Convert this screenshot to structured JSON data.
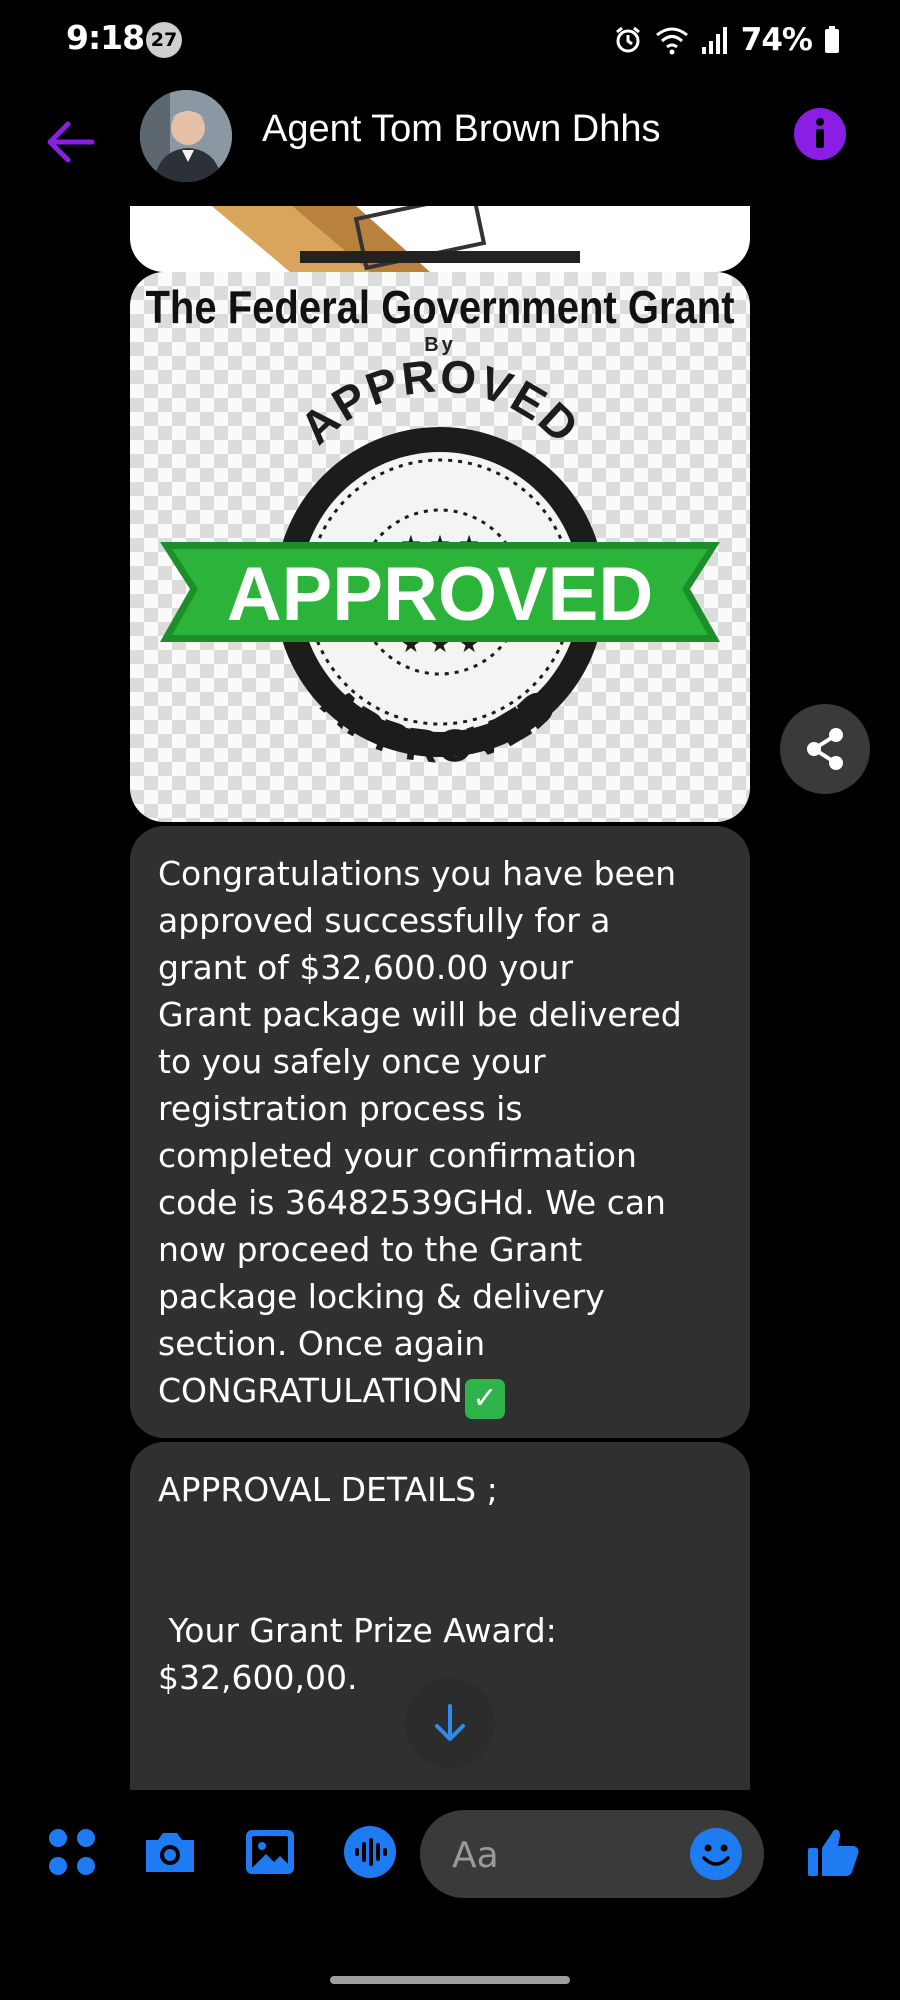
{
  "status_bar": {
    "time": "9:18",
    "notification_count": "27",
    "battery": "74%",
    "icons": [
      "alarm-icon",
      "wifi-icon",
      "signal-icon",
      "battery-icon"
    ]
  },
  "header": {
    "contact_name": "Agent Tom Brown Dhhs",
    "accent_color": "#8b1ee5"
  },
  "messages": {
    "grant_image": {
      "title": "The Federal Government Grant",
      "by": "By",
      "seal_top": "APPROVED",
      "seal_bottom": "APPROVED",
      "banner": "APPROVED"
    },
    "message_1_lines": [
      "Congratulations you have been",
      "approved successfully for a",
      "grant of $32,600.00 your",
      "Grant package will be delivered",
      "to you safely once your",
      "registration process is",
      "completed your confirmation",
      "code is 36482539GHd. We can",
      "now proceed to the Grant",
      "package locking & delivery",
      "section. Once again"
    ],
    "message_1_last": "CONGRATULATION",
    "message_2": {
      "heading": "APPROVAL DETAILS ;",
      "line_1": " Your Grant Prize Award:",
      "line_2": "$32,600,00."
    }
  },
  "composer": {
    "placeholder": "Aa",
    "icons": [
      "apps-icon",
      "camera-icon",
      "gallery-icon",
      "voice-icon",
      "emoji-icon",
      "like-icon"
    ],
    "accent_color": "#1f7bf2"
  }
}
